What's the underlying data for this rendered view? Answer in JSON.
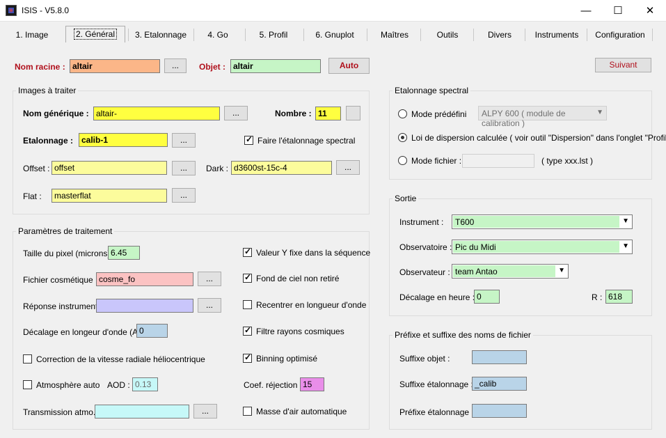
{
  "window": {
    "title": "ISIS - V5.8.0",
    "minimize": "—",
    "maximize": "☐",
    "close": "✕"
  },
  "tabs": [
    "1. Image",
    "2. Général",
    "3. Etalonnage",
    "4. Go",
    "5. Profil",
    "6. Gnuplot",
    "Maîtres",
    "Outils",
    "Divers",
    "Instruments",
    "Configuration"
  ],
  "top": {
    "nom_racine_label": "Nom racine :",
    "nom_racine_value": "altair",
    "browse": "...",
    "objet_label": "Objet :",
    "objet_value": "altair",
    "auto_button": "Auto",
    "suivant_button": "Suivant"
  },
  "images": {
    "title": "Images à traiter",
    "nom_generique_label": "Nom générique :",
    "nom_generique_value": "altair-",
    "nombre_label": "Nombre :",
    "nombre_value": "11",
    "etalonnage_label": "Etalonnage :",
    "etalonnage_value": "calib-1",
    "faire_label": "Faire l'étalonnage spectral",
    "offset_label": "Offset :",
    "offset_value": "offset",
    "dark_label": "Dark :",
    "dark_value": "d3600st-15c-4",
    "flat_label": "Flat :",
    "flat_value": "masterflat"
  },
  "params": {
    "title": "Paramètres de traitement",
    "taille_label": "Taille du pixel (microns) :",
    "taille_value": "6.45",
    "cosm_label": "Fichier cosmétique :",
    "cosm_value": "cosme_fo",
    "reponse_label": "Réponse instrument :",
    "reponse_value": "",
    "decal_label": "Décalage en longeur d'onde (A) :",
    "decal_value": "0",
    "correction_label": "Correction de la vitesse radiale héliocentrique",
    "atmo_label": "Atmosphère auto",
    "aod_label": "AOD :",
    "aod_value": "0.13",
    "transmission_label": "Transmission atmo. :",
    "transmission_value": "",
    "valeury_label": "Valeur Y fixe dans la séquence",
    "fond_label": "Fond de ciel non retiré",
    "recentrer_label": "Recentrer en longueur d'onde",
    "filtre_label": "Filtre rayons cosmiques",
    "binning_label": "Binning optimisé",
    "coef_label": "Coef. réjection :",
    "coef_value": "15",
    "masse_label": "Masse d'air automatique"
  },
  "etal": {
    "title": "Etalonnage spectral",
    "mode_predef_label": "Mode prédéfini",
    "mode_predef_combo": "ALPY 600 ( module de calibration )",
    "loi_label": "Loi de dispersion calculée ( voir outil \"Dispersion\" dans l'onglet \"Profil\" )",
    "mode_fichier_label": "Mode fichier :",
    "mode_fichier_value": "",
    "type_label": "( type xxx.lst )"
  },
  "sortie": {
    "title": "Sortie",
    "instrument_label": "Instrument :",
    "instrument_value": "T600",
    "observatoire_label": "Observatoire :",
    "observatoire_value": "Pic du Midi",
    "observateur_label": "Observateur :",
    "observateur_value": "team Antao",
    "decalage_label": "Décalage en heure :",
    "decalage_value": "0",
    "r_label": "R :",
    "r_value": "618"
  },
  "prefixe": {
    "title": "Préfixe et suffixe des noms de fichier",
    "suffixe_objet_label": "Suffixe objet :",
    "suffixe_objet_value": "",
    "suffixe_etal_label": "Suffixe étalonnage :",
    "suffixe_etal_value": "_calib",
    "prefixe_etal_label": "Préfixe étalonnage :",
    "prefixe_etal_value": ""
  },
  "colors": {
    "orange": "#fbb688",
    "green": "#c6f5c6",
    "yellow": "#ffff40",
    "lightyellow": "#fcfc9c",
    "pink": "#fbc2c2",
    "lavender": "#c9c6fb",
    "lightblue": "#b9d4e8",
    "cyan": "#c6f8f8",
    "magenta": "#e98ee9"
  }
}
